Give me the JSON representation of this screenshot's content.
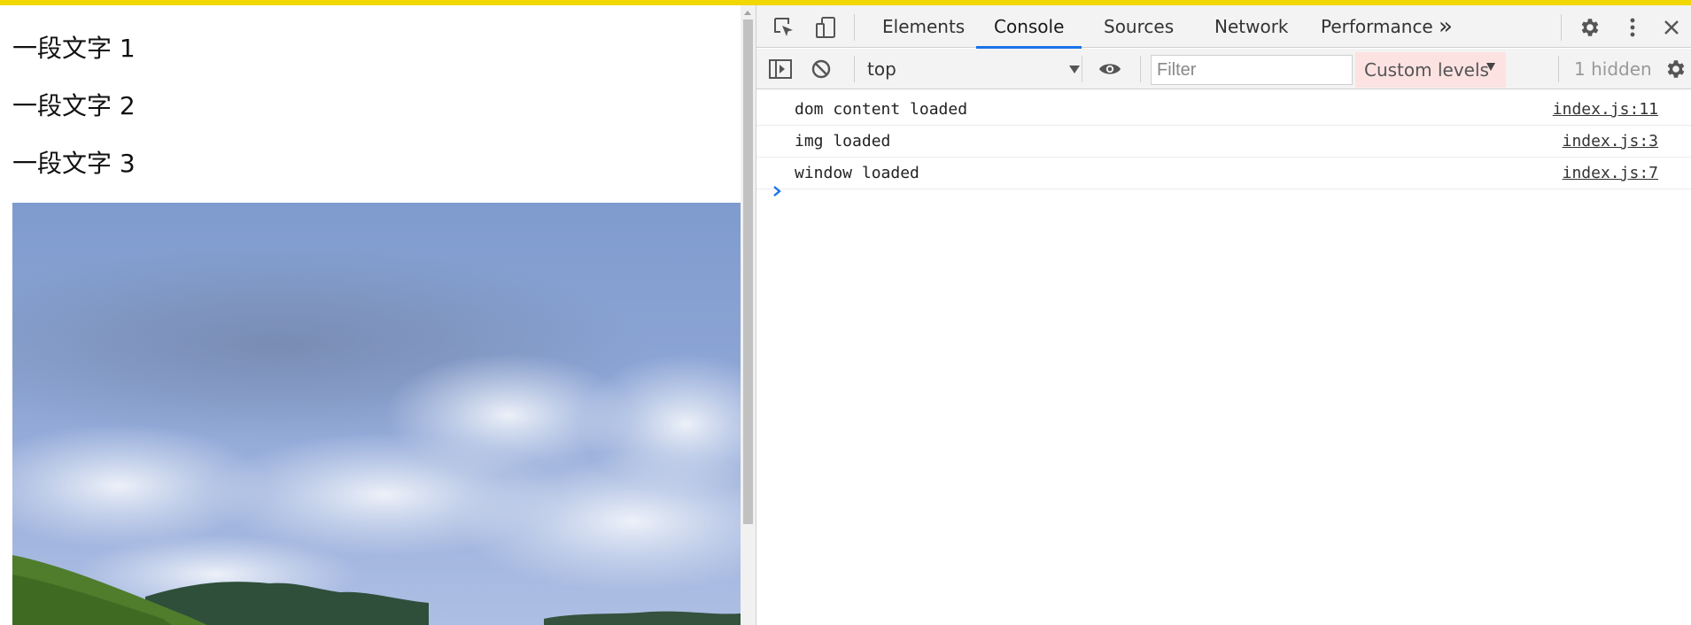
{
  "page": {
    "paragraphs": [
      "一段文字 1",
      "一段文字 2",
      "一段文字 3"
    ],
    "image_alt": "landscape photo with sky and green hill"
  },
  "devtools": {
    "tabs": [
      {
        "label": "Elements",
        "active": false
      },
      {
        "label": "Console",
        "active": true
      },
      {
        "label": "Sources",
        "active": false
      },
      {
        "label": "Network",
        "active": false
      },
      {
        "label": "Performance",
        "active": false
      }
    ],
    "icons": {
      "inspect": "inspect-element-icon",
      "device": "device-toolbar-icon",
      "more_tabs": "chevrons-right-icon",
      "settings": "gear-icon",
      "menu": "kebab-menu-icon",
      "close": "close-icon"
    },
    "toolbar": {
      "context": "top",
      "filter_placeholder": "Filter",
      "filter_value": "",
      "levels_label": "Custom levels",
      "hidden_count": "1 hidden"
    },
    "messages": [
      {
        "text": "dom content loaded",
        "source": "index.js:11"
      },
      {
        "text": "img loaded",
        "source": "index.js:3"
      },
      {
        "text": "window loaded",
        "source": "index.js:7"
      }
    ],
    "colors": {
      "accent": "#1a73e8",
      "levels_bg": "#fde2e2",
      "top_strip": "#f2d700"
    }
  }
}
